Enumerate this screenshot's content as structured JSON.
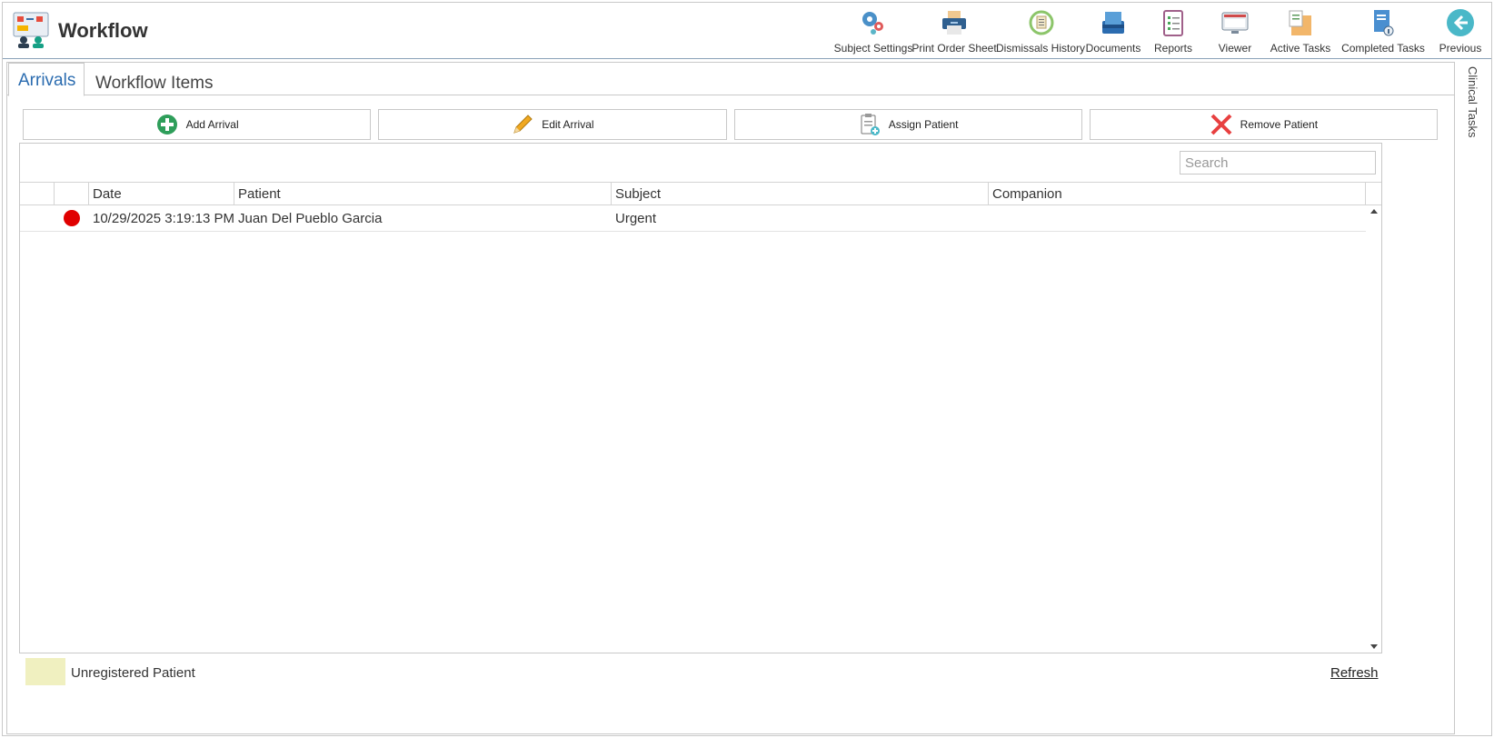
{
  "header": {
    "title": "Workflow",
    "toolbar": [
      {
        "label": "Subject Settings",
        "icon": "gears-icon"
      },
      {
        "label": "Print Order Sheet",
        "icon": "printer-icon"
      },
      {
        "label": "Dismissals History",
        "icon": "history-icon"
      },
      {
        "label": "Documents",
        "icon": "documents-icon"
      },
      {
        "label": "Reports",
        "icon": "reports-icon"
      },
      {
        "label": "Viewer",
        "icon": "viewer-icon"
      },
      {
        "label": "Active Tasks",
        "icon": "active-tasks-icon"
      },
      {
        "label": "Completed Tasks",
        "icon": "completed-tasks-icon"
      },
      {
        "label": "Previous",
        "icon": "back-arrow-icon"
      }
    ]
  },
  "side_tab": {
    "label": "Clinical Tasks"
  },
  "tabs": [
    {
      "label": "Arrivals",
      "active": true
    },
    {
      "label": "Workflow Items",
      "active": false
    }
  ],
  "actions": {
    "add_arrival": "Add Arrival",
    "edit_arrival": "Edit Arrival",
    "assign_patient": "Assign Patient",
    "remove_patient": "Remove Patient"
  },
  "search": {
    "placeholder": "Search",
    "value": ""
  },
  "grid": {
    "columns": [
      "",
      "",
      "Date",
      "Patient",
      "Subject",
      "Companion"
    ],
    "rows": [
      {
        "status_color": "#e00000",
        "date": "10/29/2025 3:19:13 PM",
        "patient": "Juan Del Pueblo Garcia",
        "subject": "Urgent",
        "companion": ""
      }
    ]
  },
  "legend": {
    "label": "Unregistered Patient",
    "color": "#f0f0c0"
  },
  "refresh_label": "Refresh"
}
